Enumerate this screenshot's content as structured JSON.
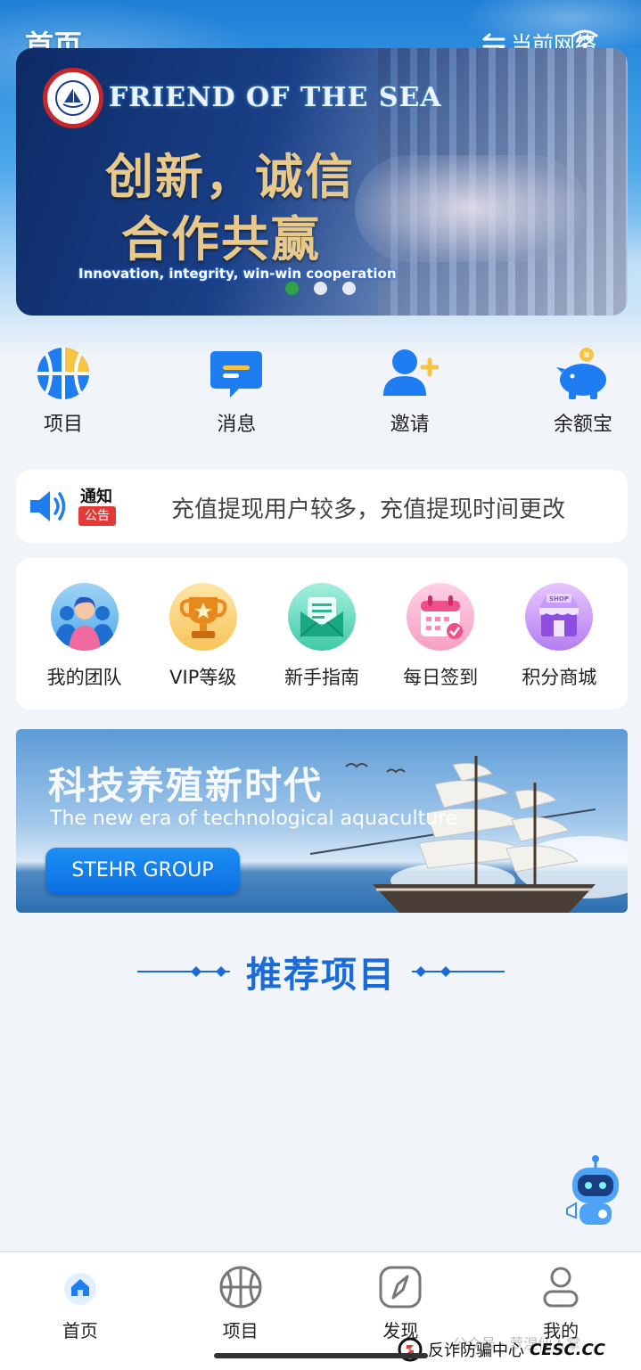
{
  "header": {
    "title": "首页",
    "network_label": "当前网络"
  },
  "banner": {
    "brand": "FRIEND OF THE SEA",
    "headline_1": "创新，诚信",
    "headline_2": "合作共赢",
    "tagline": "Innovation, integrity, win-win cooperation",
    "slides": 3,
    "active_slide": 1
  },
  "quick_actions": [
    {
      "label": "项目",
      "icon": "basketball-icon"
    },
    {
      "label": "消息",
      "icon": "message-icon"
    },
    {
      "label": "邀请",
      "icon": "invite-user-icon"
    },
    {
      "label": "余额宝",
      "icon": "piggy-bank-icon"
    }
  ],
  "notice": {
    "title": "通知",
    "badge": "公告",
    "text": "充值提现用户较多，充值提现时间更改"
  },
  "features": [
    {
      "label": "我的团队",
      "icon": "team-icon"
    },
    {
      "label": "VIP等级",
      "icon": "trophy-icon"
    },
    {
      "label": "新手指南",
      "icon": "guide-envelope-icon"
    },
    {
      "label": "每日签到",
      "icon": "calendar-icon"
    },
    {
      "label": "积分商城",
      "icon": "shop-icon"
    }
  ],
  "promo": {
    "title": "科技养殖新时代",
    "subtitle": "The new era of technological aquaculture",
    "button": "STEHR GROUP"
  },
  "section": {
    "title": "推荐项目"
  },
  "tabbar": [
    {
      "label": "首页",
      "active": true
    },
    {
      "label": "项目",
      "active": false
    },
    {
      "label": "发现",
      "active": false
    },
    {
      "label": "我的",
      "active": false
    }
  ],
  "watermark": {
    "faint": "公众号 · 萝涅仙人掌",
    "center": "反诈防骗中心",
    "brand": "CESC.CC"
  },
  "colors": {
    "accent": "#1a6ad8",
    "notice_badge": "#e53935",
    "active_dot": "#2ea34a"
  }
}
